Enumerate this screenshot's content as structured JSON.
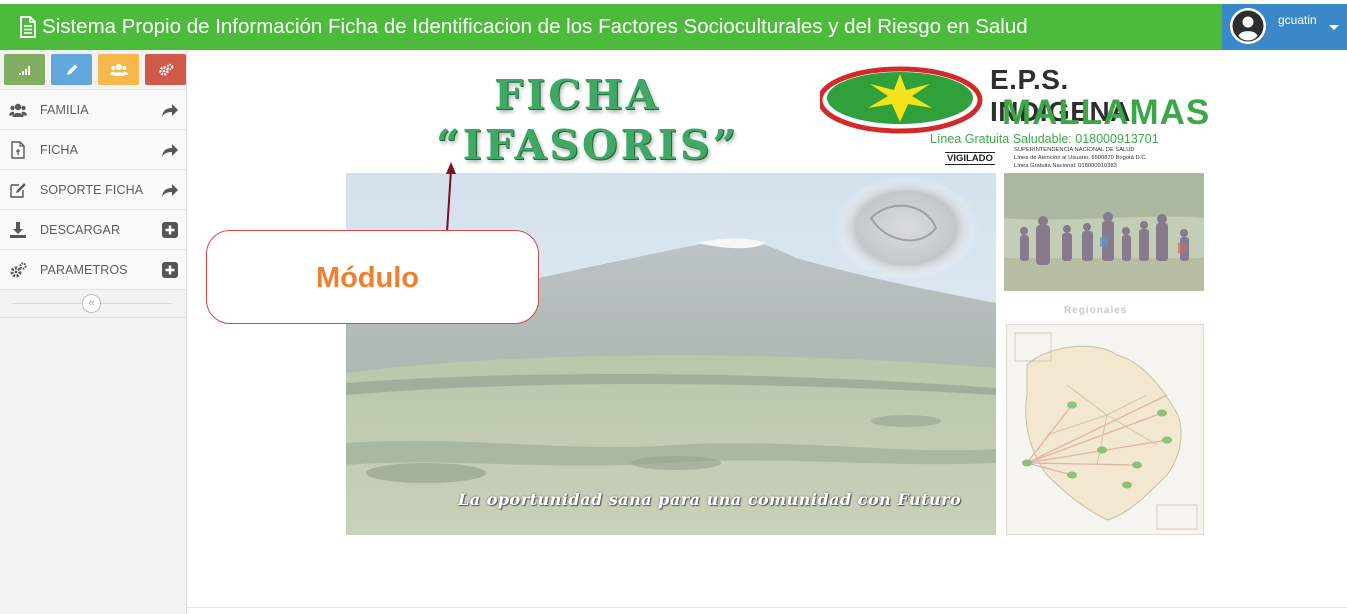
{
  "header": {
    "title": "Sistema Propio de Información Ficha de Identificacion de los Factores Socioculturales y del Riesgo en Salud",
    "username": "gcuatin",
    "doc_icon": "document-icon",
    "avatar_icon": "user-avatar-icon"
  },
  "sidebar": {
    "shortcuts": [
      {
        "icon": "signal-icon",
        "color": "#82ae62"
      },
      {
        "icon": "pencil-icon",
        "color": "#64a7dc"
      },
      {
        "icon": "users-icon",
        "color": "#f7b74b"
      },
      {
        "icon": "cogs-icon",
        "color": "#d05a4a"
      }
    ],
    "items": [
      {
        "label": "FAMILIA",
        "icon": "users-icon",
        "action_icon": "share-arrow-icon"
      },
      {
        "label": "FICHA",
        "icon": "file-icon",
        "action_icon": "share-arrow-icon"
      },
      {
        "label": "SOPORTE FICHA",
        "icon": "edit-icon",
        "action_icon": "share-arrow-icon"
      },
      {
        "label": "DESCARGAR",
        "icon": "download-icon",
        "action_icon": "plus-square-icon"
      },
      {
        "label": "PARAMETROS",
        "icon": "cogs-icon",
        "action_icon": "plus-square-icon"
      }
    ],
    "collapse_icon": "double-chevron-left-icon"
  },
  "banner": {
    "ficha_line1": "FICHA",
    "ficha_line2": "“IFASORIS”",
    "eps_title": "E.P.S. INDIGENA",
    "eps_brand": "MALLAMAS",
    "eps_phone": "Línea Gratuita Saludable: 018000913701",
    "eps_vigilado": "VIGILADO",
    "eps_small1": "SUPERINTENDENCIA NACIONAL DE SALUD",
    "eps_small2": "Línea de Atención al Usuario: 6500870 Bogotá D.C.",
    "eps_small3": "Línea Gratuita Nacional: 018000910383",
    "slogan": "La oportunidad sana para una comunidad con Futuro",
    "regionales": "Regionales"
  },
  "annotation": {
    "label": "Módulo",
    "text_color": "#f07f2e",
    "border_color": "#d8454a",
    "arrow_color": "#7a1021"
  },
  "colors": {
    "header_green": "#4cbb3b",
    "user_blue": "#3b88c8"
  }
}
